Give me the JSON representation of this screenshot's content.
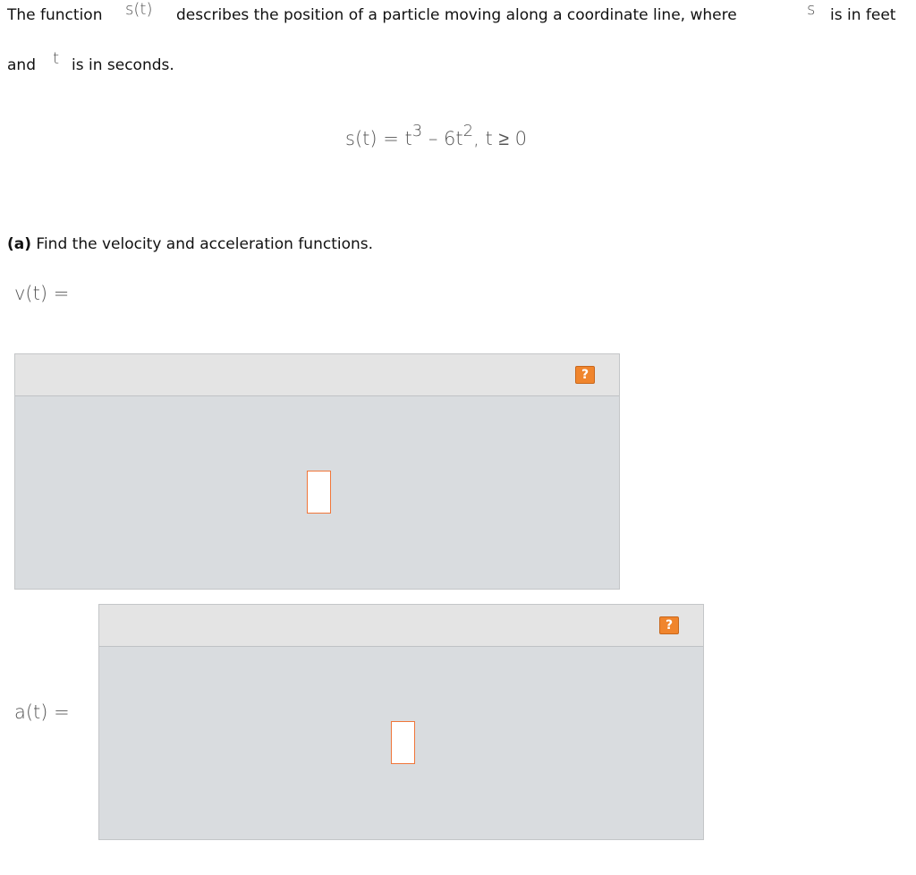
{
  "intro": {
    "text1": "The function",
    "func_symbol": "s(t)",
    "text2": "describes the position of a particle moving along a coordinate line, where",
    "s_symbol": "s",
    "text3": "is in feet",
    "text4": "and",
    "t_symbol": "t",
    "text5": "is in seconds."
  },
  "formula": {
    "lhs": "s(t) = t",
    "exp1": "3",
    "mid": " – 6t",
    "exp2": "2",
    "rhs": ", t ≥ 0"
  },
  "part_a": {
    "label": "(a)",
    "prompt": "Find the velocity and acceleration functions."
  },
  "velocity": {
    "label": "v(t) =",
    "help_label": "?"
  },
  "acceleration": {
    "label": "a(t) =",
    "help_label": "?"
  },
  "colors": {
    "help_button": "#f0852d",
    "slot_border": "#f0763a",
    "box_bg": "#d9dcdf",
    "toolbar_bg": "#e4e4e4"
  }
}
